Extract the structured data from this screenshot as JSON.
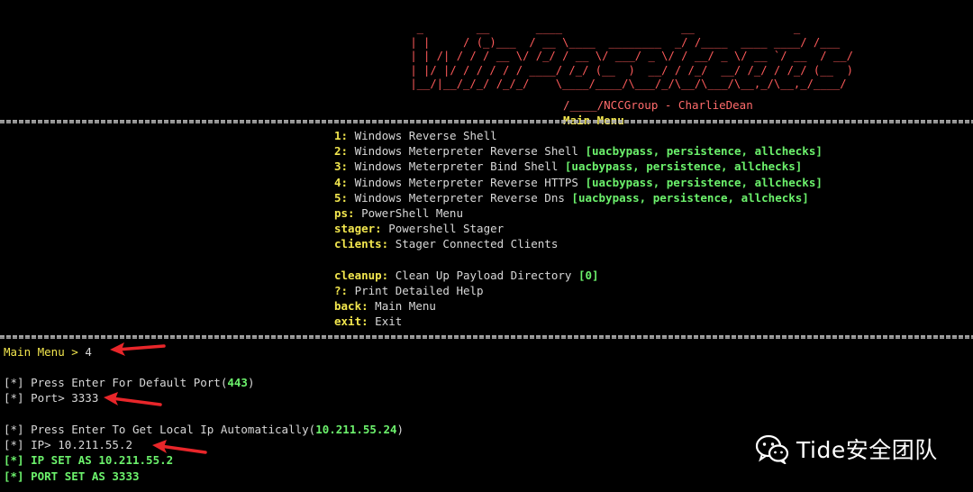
{
  "banner": {
    "ascii_art": "  _        __       ____                  __               _\n | |     / (_)___  / __ \\____  ________  _/ /____  ____ ____/ /___\n | | /| / / / __ \\/ /_/ / __ \\/ ___/ _ \\/ / __/ _ \\/ __ `/ __  / __/\n | |/ |/ / / / / / ____/ /_/ (__  )  __/ / /_/  __/ /_/ / /_/ (__  )\n |__/|__/_/_/ /_/_/    \\____/____/\\___/_/\\__/\\___/\\__,_/\\__,_/____/",
    "credit": "/____/NCCGroup - CharlieDean",
    "menu_title": "Main Menu"
  },
  "menu": {
    "items": [
      {
        "key": "1:",
        "text": " Windows Reverse Shell",
        "tag": ""
      },
      {
        "key": "2:",
        "text": " Windows Meterpreter Reverse Shell ",
        "tag": "[uacbypass, persistence, allchecks]"
      },
      {
        "key": "3:",
        "text": " Windows Meterpreter Bind Shell ",
        "tag": "[uacbypass, persistence, allchecks]"
      },
      {
        "key": "4:",
        "text": " Windows Meterpreter Reverse HTTPS ",
        "tag": "[uacbypass, persistence, allchecks]"
      },
      {
        "key": "5:",
        "text": " Windows Meterpreter Reverse Dns ",
        "tag": "[uacbypass, persistence, allchecks]"
      },
      {
        "key": "ps:",
        "text": " PowerShell Menu",
        "tag": ""
      },
      {
        "key": "stager:",
        "text": " Powershell Stager",
        "tag": ""
      },
      {
        "key": "clients:",
        "text": " Stager Connected Clients",
        "tag": ""
      }
    ],
    "items2": [
      {
        "key": "cleanup:",
        "text": " Clean Up Payload Directory ",
        "tag": "[0]"
      },
      {
        "key": "?:",
        "text": " Print Detailed Help",
        "tag": ""
      },
      {
        "key": "back:",
        "text": " Main Menu",
        "tag": ""
      },
      {
        "key": "exit:",
        "text": " Exit",
        "tag": ""
      }
    ]
  },
  "session": {
    "prompt_label": "Main Menu",
    "prompt_symbol": " > ",
    "prompt_input": "4",
    "port_hint_prefix": "[*] Press Enter For Default Port(",
    "port_default": "443",
    "port_hint_suffix": ")",
    "port_prompt": "[*] Port> 3333",
    "ip_hint_prefix": "[*] Press Enter To Get Local Ip Automatically(",
    "ip_default": "10.211.55.24",
    "ip_hint_suffix": ")",
    "ip_prompt": "[*] IP> 10.211.55.2",
    "ip_set": "[*] IP SET AS 10.211.55.2",
    "port_set": "[*] PORT SET AS 3333"
  },
  "watermark": {
    "icon": "wechat-icon",
    "text": "Tide安全团队"
  },
  "colors": {
    "background": "#000000",
    "banner_red": "#ff5b5b",
    "key_yellow": "#f2e64e",
    "tag_green": "#6cf26c",
    "arrow_red": "#e8262a"
  }
}
